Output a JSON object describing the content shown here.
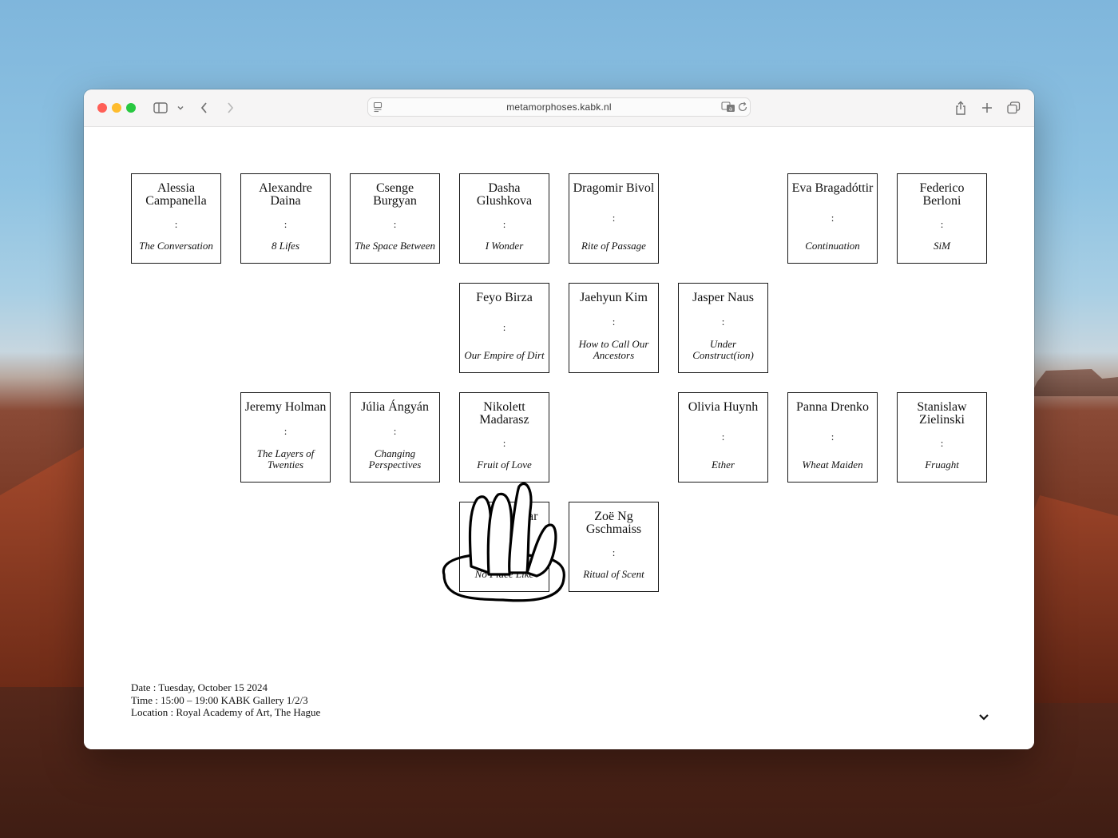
{
  "browser": {
    "url": "metamorphoses.kabk.nl",
    "colors": {
      "close": "#ff5f57",
      "minimize": "#febc2e",
      "zoom": "#28c840"
    },
    "icons": {
      "sidebar": "sidebar-icon",
      "back": "chevron-left-icon",
      "forward": "chevron-right-icon",
      "share": "share-icon",
      "new_tab": "plus-icon",
      "tabs": "tab-overview-icon",
      "translate": "translate-icon",
      "reload": "reload-icon"
    }
  },
  "projects": [
    {
      "name": "Alessia Campanella",
      "separator": ":",
      "title": "The Conversation"
    },
    {
      "name": "Alexandre Daina",
      "separator": ":",
      "title": "8 Lifes"
    },
    {
      "name": "Csenge Burgyan",
      "separator": ":",
      "title": "The Space Between"
    },
    {
      "name": "Dasha Glushkova",
      "separator": ":",
      "title": "I Wonder"
    },
    {
      "name": "Dragomir Bivol",
      "separator": ":",
      "title": "Rite of Passage"
    },
    {
      "name": "Eva Bragadóttir",
      "separator": ":",
      "title": "Continuation"
    },
    {
      "name": "Federico Berloni",
      "separator": ":",
      "title": "SiM"
    },
    {
      "name": "Feyo Birza",
      "separator": ":",
      "title": "Our Empire of Dirt"
    },
    {
      "name": "Jaehyun Kim",
      "separator": ":",
      "title": "How to Call Our Ancestors"
    },
    {
      "name": "Jasper Naus",
      "separator": ":",
      "title": "Under Construct(ion)"
    },
    {
      "name": "Jeremy Holman",
      "separator": ":",
      "title": "The Layers of Twenties"
    },
    {
      "name": "Júlia Ángyán",
      "separator": ":",
      "title": "Changing Perspectives"
    },
    {
      "name": "Nikolett Madarasz",
      "separator": ":",
      "title": "Fruit of Love"
    },
    {
      "name": "Olivia Huynh",
      "separator": ":",
      "title": "Ether"
    },
    {
      "name": "Panna Drenko",
      "separator": ":",
      "title": "Wheat Maiden"
    },
    {
      "name": "Stanislaw Zielinski",
      "separator": ":",
      "title": "Fruaght"
    },
    {
      "name": "Vin Engelaar",
      "separator": ":",
      "title": "No Place Like"
    },
    {
      "name": "Zoë Ng Gschmaiss",
      "separator": ":",
      "title": "Ritual of Scent"
    }
  ],
  "event": {
    "date": "Date : Tuesday, October 15 2024",
    "time": "Time : 15:00 – 19:00 KABK Gallery 1/2/3",
    "location": "Location : Royal Academy of Art, The Hague"
  },
  "icons": {
    "scroll_down": "chevron-down-icon",
    "cursor_drawing": "cactus-drawing-icon"
  }
}
